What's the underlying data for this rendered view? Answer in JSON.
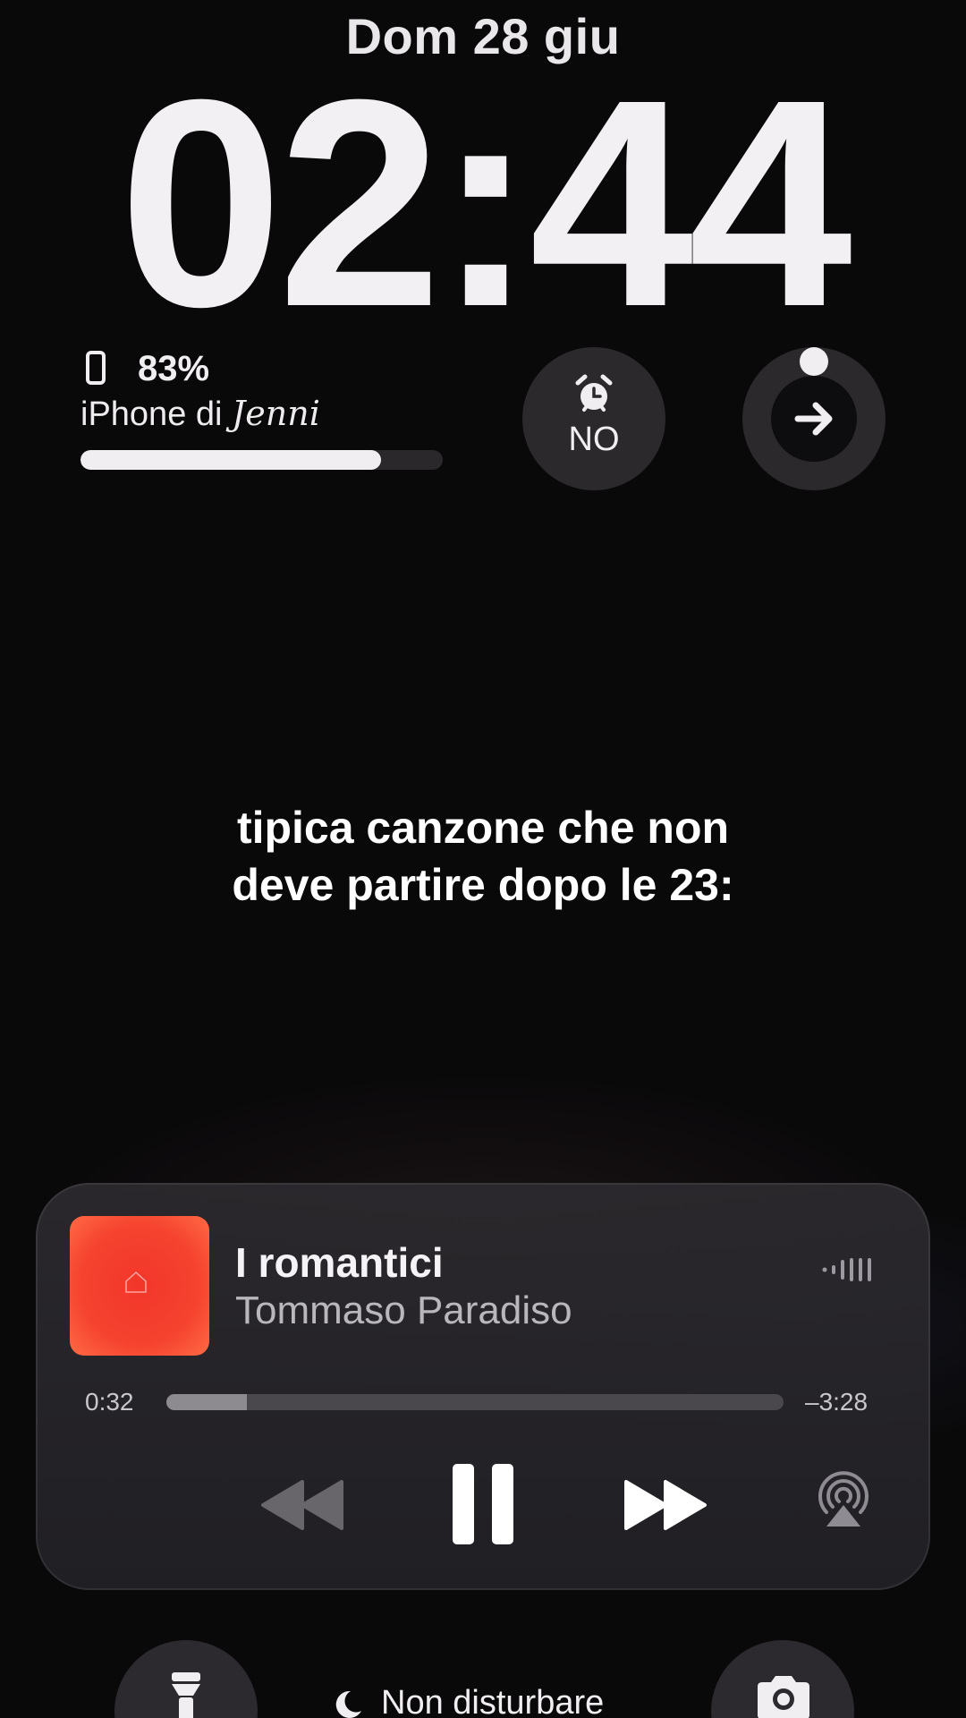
{
  "lock_screen": {
    "date": "Dom 28 giu",
    "time": "02:44"
  },
  "widgets": {
    "battery": {
      "percent_text": "83%",
      "level": 0.83,
      "device_prefix": "iPhone di",
      "device_owner": "Jenni",
      "icon": "phone-icon"
    },
    "alarm": {
      "label": "NO",
      "icon": "alarm-clock-icon"
    },
    "navigation": {
      "icon": "arrow-right-icon"
    }
  },
  "caption": {
    "line1": "tipica canzone che non",
    "line2": "deve partire dopo le 23:"
  },
  "now_playing": {
    "title": "I romantici",
    "artist": "Tommaso Paradiso",
    "elapsed": "0:32",
    "remaining": "–3:28",
    "progress": 0.13,
    "album_color": "#f5432f",
    "controls": {
      "rewind": "rewind-icon",
      "pause": "pause-icon",
      "forward": "fast-forward-icon",
      "airplay": "airplay-icon"
    }
  },
  "quick_actions": {
    "flashlight": "flashlight-icon",
    "camera": "camera-icon",
    "focus_label": "Non disturbare",
    "focus_icon": "moon-icon"
  }
}
